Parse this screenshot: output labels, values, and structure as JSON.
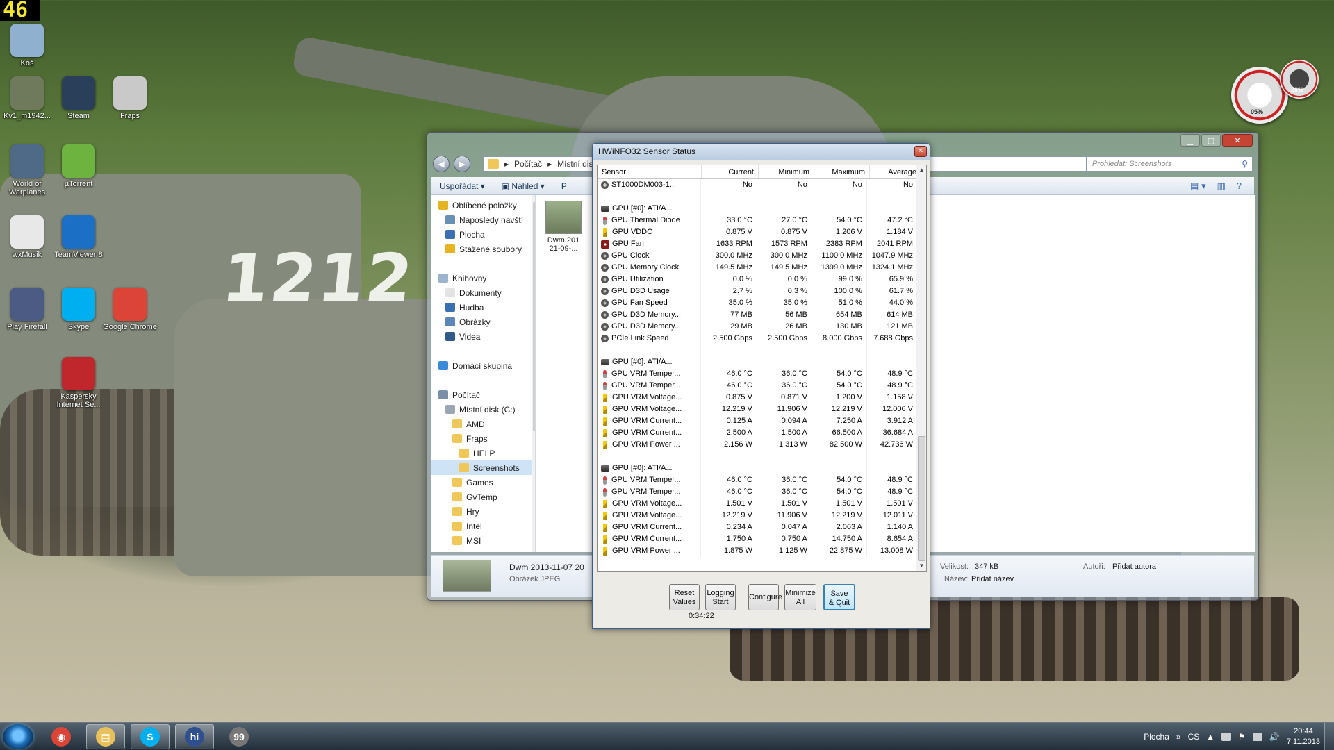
{
  "fps": "46",
  "desktop_icons": [
    {
      "label": "Koš",
      "icon": "recycle-bin-icon",
      "color": "#8fb1cf"
    },
    {
      "label": "Kv1_m1942...",
      "icon": "tank-icon",
      "color": "#6f7a5c"
    },
    {
      "label": "Steam",
      "icon": "steam-icon",
      "color": "#2a3f5a"
    },
    {
      "label": "Fraps",
      "icon": "fraps-icon",
      "color": "#c9c9c9"
    },
    {
      "label": "World of Warplanes",
      "icon": "warplanes-icon",
      "color": "#4e6a86"
    },
    {
      "label": "µTorrent",
      "icon": "utorrent-icon",
      "color": "#6cb33f"
    },
    {
      "label": "wxMusik",
      "icon": "wxmusik-icon",
      "color": "#e8e8e8"
    },
    {
      "label": "TeamViewer 8",
      "icon": "teamviewer-icon",
      "color": "#1b6fc4"
    },
    {
      "label": "Play Firefall",
      "icon": "firefall-icon",
      "color": "#4b5b84"
    },
    {
      "label": "Skype",
      "icon": "skype-icon",
      "color": "#00aff0"
    },
    {
      "label": "Google Chrome",
      "icon": "chrome-icon",
      "color": "#db4437"
    },
    {
      "label": "Kaspersky Internet Se...",
      "icon": "kaspersky-icon",
      "color": "#c0272d"
    }
  ],
  "gadget": {
    "value1": "05%",
    "value2": "29%"
  },
  "explorer": {
    "address": [
      "Počítač",
      "Místní disk"
    ],
    "search_placeholder": "Prohledat: Screenshots",
    "toolbar": {
      "organize": "Uspořádat",
      "preview": "Náhled",
      "more": "P"
    },
    "nav": [
      {
        "label": "Oblíbené položky",
        "icon": "star-icon",
        "color": "#e6b422",
        "level": 0
      },
      {
        "label": "Naposledy navští",
        "icon": "recent-icon",
        "color": "#6a8fb5",
        "level": 1
      },
      {
        "label": "Plocha",
        "icon": "desktop-icon",
        "color": "#3a6fb0",
        "level": 1
      },
      {
        "label": "Stažené soubory",
        "icon": "downloads-icon",
        "color": "#e6b422",
        "level": 1
      },
      {
        "label": "",
        "icon": "",
        "color": "",
        "level": 0
      },
      {
        "label": "Knihovny",
        "icon": "library-icon",
        "color": "#9bb3cc",
        "level": 0
      },
      {
        "label": "Dokumenty",
        "icon": "documents-icon",
        "color": "#e3e3e3",
        "level": 1
      },
      {
        "label": "Hudba",
        "icon": "music-icon",
        "color": "#3a6fb0",
        "level": 1
      },
      {
        "label": "Obrázky",
        "icon": "pictures-icon",
        "color": "#5a86b8",
        "level": 1
      },
      {
        "label": "Videa",
        "icon": "video-icon",
        "color": "#2f5a8a",
        "level": 1
      },
      {
        "label": "",
        "icon": "",
        "color": "",
        "level": 0
      },
      {
        "label": "Domácí skupina",
        "icon": "homegroup-icon",
        "color": "#3a8ad8",
        "level": 0
      },
      {
        "label": "",
        "icon": "",
        "color": "",
        "level": 0
      },
      {
        "label": "Počítač",
        "icon": "computer-icon",
        "color": "#7b8fa6",
        "level": 0
      },
      {
        "label": "Místní disk (C:)",
        "icon": "drive-icon",
        "color": "#9aa6b2",
        "level": 1
      },
      {
        "label": "AMD",
        "icon": "folder-icon",
        "color": "#f0c85a",
        "level": 2
      },
      {
        "label": "Fraps",
        "icon": "folder-icon",
        "color": "#f0c85a",
        "level": 2
      },
      {
        "label": "HELP",
        "icon": "folder-icon",
        "color": "#f0c85a",
        "level": 3
      },
      {
        "label": "Screenshots",
        "icon": "folder-icon",
        "color": "#f0c85a",
        "level": 3,
        "selected": true
      },
      {
        "label": "Games",
        "icon": "folder-icon",
        "color": "#f0c85a",
        "level": 2
      },
      {
        "label": "GvTemp",
        "icon": "folder-icon",
        "color": "#f0c85a",
        "level": 2
      },
      {
        "label": "Hry",
        "icon": "folder-icon",
        "color": "#f0c85a",
        "level": 2
      },
      {
        "label": "Intel",
        "icon": "folder-icon",
        "color": "#f0c85a",
        "level": 2
      },
      {
        "label": "MSI",
        "icon": "folder-icon",
        "color": "#f0c85a",
        "level": 2
      }
    ],
    "file": {
      "name_line1": "Dwm 201",
      "name_line2": "21-09-..."
    },
    "details": {
      "name": "Dwm 2013-11-07 20",
      "type": "Obrázek JPEG",
      "size_label": "Velikost:",
      "size_value": "347 kB",
      "title_label": "Název:",
      "title_value": "Přidat název",
      "author_label": "Autoři:",
      "author_value": "Přidat autora"
    }
  },
  "hwinfo": {
    "title": "HWiNFO32 Sensor Status",
    "columns": [
      "Sensor",
      "Current",
      "Minimum",
      "Maximum",
      "Average"
    ],
    "rows": [
      {
        "icon": "disk",
        "name": "ST1000DM003-1...",
        "cur": "No",
        "min": "No",
        "max": "No",
        "avg": "No"
      },
      {
        "icon": "blank",
        "name": "",
        "cur": "",
        "min": "",
        "max": "",
        "avg": ""
      },
      {
        "icon": "gpu",
        "name": "GPU [#0]: ATI/A...",
        "cur": "",
        "min": "",
        "max": "",
        "avg": ""
      },
      {
        "icon": "temp",
        "name": "GPU Thermal Diode",
        "cur": "33.0 °C",
        "min": "27.0 °C",
        "max": "54.0 °C",
        "avg": "47.2 °C"
      },
      {
        "icon": "volt",
        "name": "GPU VDDC",
        "cur": "0.875 V",
        "min": "0.875 V",
        "max": "1.206 V",
        "avg": "1.184 V"
      },
      {
        "icon": "fan",
        "name": "GPU Fan",
        "cur": "1633 RPM",
        "min": "1573 RPM",
        "max": "2383 RPM",
        "avg": "2041 RPM"
      },
      {
        "icon": "gauge",
        "name": "GPU Clock",
        "cur": "300.0 MHz",
        "min": "300.0 MHz",
        "max": "1100.0 MHz",
        "avg": "1047.9 MHz"
      },
      {
        "icon": "gauge",
        "name": "GPU Memory Clock",
        "cur": "149.5 MHz",
        "min": "149.5 MHz",
        "max": "1399.0 MHz",
        "avg": "1324.1 MHz"
      },
      {
        "icon": "gauge",
        "name": "GPU Utilization",
        "cur": "0.0 %",
        "min": "0.0 %",
        "max": "99.0 %",
        "avg": "65.9 %"
      },
      {
        "icon": "gauge",
        "name": "GPU D3D Usage",
        "cur": "2.7 %",
        "min": "0.3 %",
        "max": "100.0 %",
        "avg": "61.7 %"
      },
      {
        "icon": "gauge",
        "name": "GPU Fan Speed",
        "cur": "35.0 %",
        "min": "35.0 %",
        "max": "51.0 %",
        "avg": "44.0 %"
      },
      {
        "icon": "gauge",
        "name": "GPU D3D Memory...",
        "cur": "77 MB",
        "min": "56 MB",
        "max": "654 MB",
        "avg": "614 MB"
      },
      {
        "icon": "gauge",
        "name": "GPU D3D Memory...",
        "cur": "29 MB",
        "min": "26 MB",
        "max": "130 MB",
        "avg": "121 MB"
      },
      {
        "icon": "gauge",
        "name": "PCIe Link Speed",
        "cur": "2.500 Gbps",
        "min": "2.500 Gbps",
        "max": "8.000 Gbps",
        "avg": "7.688 Gbps"
      },
      {
        "icon": "blank",
        "name": "",
        "cur": "",
        "min": "",
        "max": "",
        "avg": ""
      },
      {
        "icon": "gpu",
        "name": "GPU [#0]: ATI/A...",
        "cur": "",
        "min": "",
        "max": "",
        "avg": ""
      },
      {
        "icon": "temp",
        "name": "GPU VRM Temper...",
        "cur": "46.0 °C",
        "min": "36.0 °C",
        "max": "54.0 °C",
        "avg": "48.9 °C"
      },
      {
        "icon": "temp",
        "name": "GPU VRM Temper...",
        "cur": "46.0 °C",
        "min": "36.0 °C",
        "max": "54.0 °C",
        "avg": "48.9 °C"
      },
      {
        "icon": "volt",
        "name": "GPU VRM Voltage...",
        "cur": "0.875 V",
        "min": "0.871 V",
        "max": "1.200 V",
        "avg": "1.158 V"
      },
      {
        "icon": "volt",
        "name": "GPU VRM Voltage...",
        "cur": "12.219 V",
        "min": "11.906 V",
        "max": "12.219 V",
        "avg": "12.006 V"
      },
      {
        "icon": "volt",
        "name": "GPU VRM Current...",
        "cur": "0.125 A",
        "min": "0.094 A",
        "max": "7.250 A",
        "avg": "3.912 A"
      },
      {
        "icon": "volt",
        "name": "GPU VRM Current...",
        "cur": "2.500 A",
        "min": "1.500 A",
        "max": "66.500 A",
        "avg": "36.684 A"
      },
      {
        "icon": "volt",
        "name": "GPU VRM Power ...",
        "cur": "2.156 W",
        "min": "1.313 W",
        "max": "82.500 W",
        "avg": "42.736 W"
      },
      {
        "icon": "blank",
        "name": "",
        "cur": "",
        "min": "",
        "max": "",
        "avg": ""
      },
      {
        "icon": "gpu",
        "name": "GPU [#0]: ATI/A...",
        "cur": "",
        "min": "",
        "max": "",
        "avg": ""
      },
      {
        "icon": "temp",
        "name": "GPU VRM Temper...",
        "cur": "46.0 °C",
        "min": "36.0 °C",
        "max": "54.0 °C",
        "avg": "48.9 °C"
      },
      {
        "icon": "temp",
        "name": "GPU VRM Temper...",
        "cur": "46.0 °C",
        "min": "36.0 °C",
        "max": "54.0 °C",
        "avg": "48.9 °C"
      },
      {
        "icon": "volt",
        "name": "GPU VRM Voltage...",
        "cur": "1.501 V",
        "min": "1.501 V",
        "max": "1.501 V",
        "avg": "1.501 V"
      },
      {
        "icon": "volt",
        "name": "GPU VRM Voltage...",
        "cur": "12.219 V",
        "min": "11.906 V",
        "max": "12.219 V",
        "avg": "12.011 V"
      },
      {
        "icon": "volt",
        "name": "GPU VRM Current...",
        "cur": "0.234 A",
        "min": "0.047 A",
        "max": "2.063 A",
        "avg": "1.140 A"
      },
      {
        "icon": "volt",
        "name": "GPU VRM Current...",
        "cur": "1.750 A",
        "min": "0.750 A",
        "max": "14.750 A",
        "avg": "8.654 A"
      },
      {
        "icon": "volt",
        "name": "GPU VRM Power ...",
        "cur": "1.875 W",
        "min": "1.125 W",
        "max": "22.875 W",
        "avg": "13.008 W"
      }
    ],
    "buttons": {
      "reset_1": "Reset",
      "reset_2": "Values",
      "logging_1": "Logging",
      "logging_2": "Start",
      "configure": "Configure",
      "minimize_1": "Minimize",
      "minimize_2": "All",
      "save_1": "Save",
      "save_2": "& Quit"
    },
    "elapsed": "0:34:22"
  },
  "taskbar": {
    "apps": [
      {
        "icon": "chrome-icon",
        "color": "#db4437",
        "glyph": "◉",
        "active": false
      },
      {
        "icon": "explorer-icon",
        "color": "#e8c15a",
        "glyph": "▤",
        "active": true
      },
      {
        "icon": "skype-icon",
        "color": "#00aff0",
        "glyph": "S",
        "active": true
      },
      {
        "icon": "hwinfo-icon",
        "color": "#2f4f8f",
        "glyph": "hi",
        "active": true
      },
      {
        "icon": "fraps-icon",
        "color": "#777777",
        "glyph": "99",
        "active": false
      }
    ],
    "desktop_label": "Plocha",
    "language": "CS",
    "time": "20:44",
    "date": "7.11.2013"
  }
}
